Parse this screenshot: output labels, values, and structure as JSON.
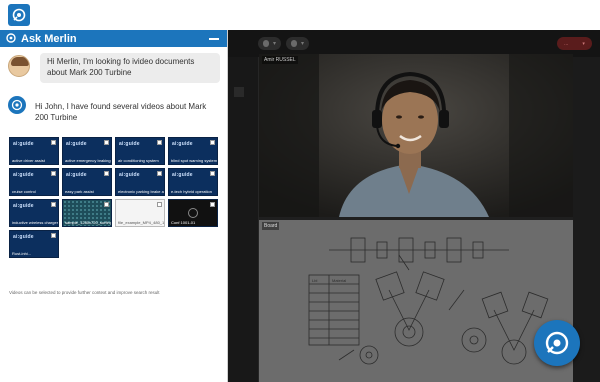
{
  "panel": {
    "title": "Ask Merlin"
  },
  "conversation": {
    "user_message": "Hi Merlin, I'm looking fo ivideo documents about Mark 200 Turbine",
    "bot_message": "Hi John, I have found several videos about Mark 200 Turbine"
  },
  "videos": [
    {
      "brand": "ai:guide",
      "label": "active driver assist",
      "style": "brand"
    },
    {
      "brand": "ai:guide",
      "label": "active emergency braking",
      "style": "brand"
    },
    {
      "brand": "ai:guide",
      "label": "air conditioning system",
      "style": "brand"
    },
    {
      "brand": "ai:guide",
      "label": "blind spot warning system",
      "style": "brand"
    },
    {
      "brand": "ai:guide",
      "label": "cruise control",
      "style": "brand"
    },
    {
      "brand": "ai:guide",
      "label": "easy park assist",
      "style": "brand"
    },
    {
      "brand": "ai:guide",
      "label": "electronic parking brake a...",
      "style": "brand"
    },
    {
      "brand": "ai:guide",
      "label": "e-tech hybrid operation",
      "style": "brand"
    },
    {
      "brand": "ai:guide",
      "label": "inductive wireless charger",
      "style": "brand"
    },
    {
      "brand": "",
      "label": "sample_1280x720_surfing...",
      "style": "texture"
    },
    {
      "brand": "",
      "label": "file_example_MP4_480_1.5...",
      "style": "white"
    },
    {
      "brand": "",
      "label": "Conf 1001-01",
      "style": "dark"
    },
    {
      "brand": "ai:guide",
      "label": "Rust-inhi...",
      "style": "brand"
    }
  ],
  "footnote": "Videos can be selected to provide further context and improve search result",
  "meeting": {
    "participant_top": "Amir RUSSEL",
    "participant_bottom": "Board",
    "end_button": "...",
    "table_header": [
      "Lbl",
      "Material"
    ]
  },
  "colors": {
    "brand_blue": "#1c75bc",
    "meeting_bg": "#1f1f1f",
    "end_call_red": "#5a1c1c"
  },
  "icons": {
    "app_logo": "merlin-logo-icon",
    "avatar": "user-avatar",
    "bot": "merlin-bot-icon",
    "fab": "merlin-chat-fab-icon"
  }
}
